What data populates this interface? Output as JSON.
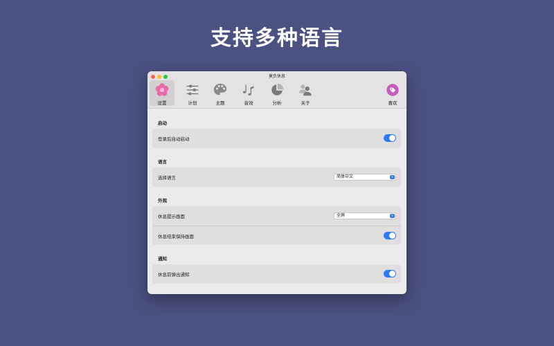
{
  "headline": "支持多种语言",
  "window": {
    "title": "莫负休息",
    "toolbar": {
      "settings": "设置",
      "plan": "计划",
      "theme": "主题",
      "sound": "音效",
      "analysis": "分析",
      "about": "关于",
      "like": "喜欢"
    }
  },
  "sections": {
    "startup": {
      "title": "启动",
      "launch_at_login": "登录后自动启动"
    },
    "language": {
      "title": "语言",
      "choose_language": "选择语言",
      "language_value": "简体中文"
    },
    "appearance": {
      "title": "外观",
      "break_screen": "休息提示画面",
      "break_screen_value": "全屏",
      "keep_screen": "休息结束保持画面"
    },
    "notification": {
      "title": "通知",
      "notify_before": "休息前弹出通知"
    }
  },
  "colors": {
    "background": "#4b5180",
    "accent": "#2a7bf5",
    "settings_icon": "#e56ba8",
    "like_icon": "#c55bbf"
  },
  "icons": {
    "settings": "flower-icon",
    "plan": "sliders-icon",
    "theme": "palette-icon",
    "sound": "music-notes-icon",
    "analysis": "pie-chart-icon",
    "about": "people-icon",
    "like": "heart-tag-icon"
  }
}
